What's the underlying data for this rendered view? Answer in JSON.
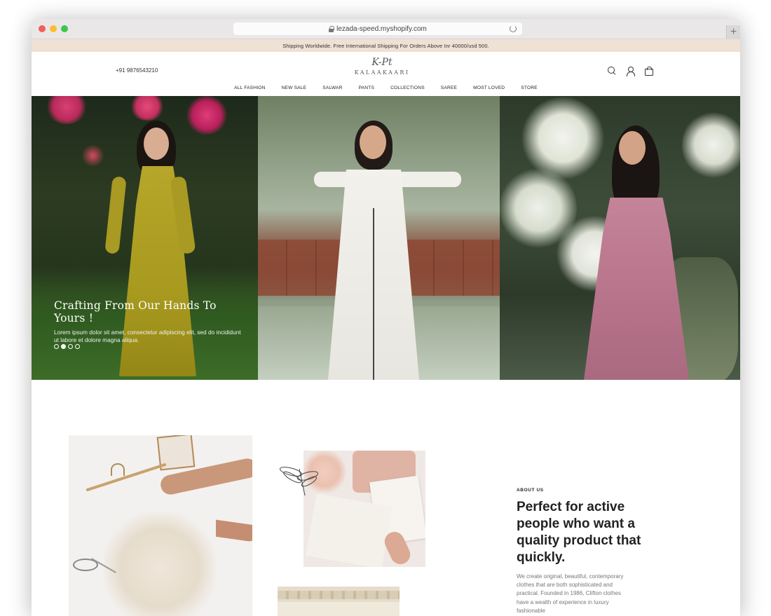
{
  "browser": {
    "url": "lezada-speed.myshopify.com"
  },
  "announcement": {
    "text": "Shipping Worldwide. Free International Shipping For Orders Above Inr 40000/usd 500."
  },
  "header": {
    "phone": "+91 9876543210",
    "logo_script": "K-Pt",
    "logo_word": "KALAAKAARI",
    "icons": [
      "search-icon",
      "user-icon",
      "bag-icon"
    ]
  },
  "nav": {
    "items": [
      "ALL FASHION",
      "NEW SALE",
      "SALWAR",
      "PANTS",
      "COLLECTIONS",
      "SAREE",
      "MOST LOVED",
      "STORE"
    ]
  },
  "hero": {
    "title": "Crafting From Our Hands To Yours !",
    "subtitle": "Lorem ipsum dolor sit amet, consectetur adipiscing elit, sed do incididunt ut labore et dolore magna aliqua.",
    "slides": 4,
    "active_slide": 2
  },
  "about": {
    "label": "ABOUT US",
    "title": "Perfect for active people who want a quality product that quickly.",
    "body": "We create original, beautiful, contemporary clothes that are both sophisticated and practical. Founded in 1986, Clifton clothes have a wealth of experience in luxury fashionable"
  },
  "colors": {
    "announcement_bg": "#efe1d4",
    "text": "#222222"
  }
}
